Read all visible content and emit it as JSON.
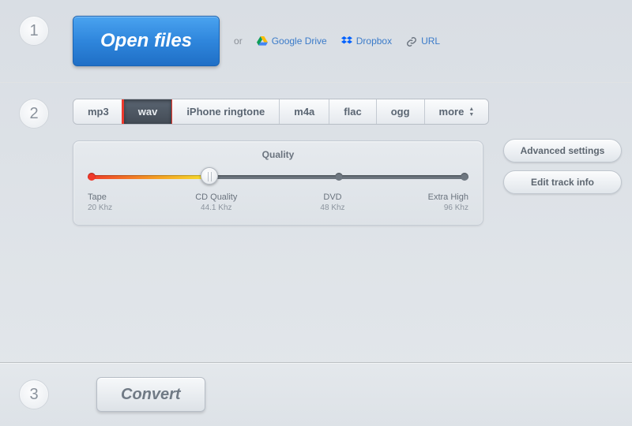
{
  "steps": {
    "one": "1",
    "two": "2",
    "three": "3"
  },
  "open": {
    "button": "Open files",
    "or": "or",
    "sources": {
      "gdrive": "Google Drive",
      "dropbox": "Dropbox",
      "url": "URL"
    }
  },
  "formats": {
    "items": [
      "mp3",
      "wav",
      "iPhone ringtone",
      "m4a",
      "flac",
      "ogg",
      "more"
    ],
    "active_index": 1,
    "highlighted_index": 1
  },
  "quality": {
    "title": "Quality",
    "stops": [
      {
        "label": "Tape",
        "value": "20 Khz"
      },
      {
        "label": "CD Quality",
        "value": "44.1 Khz"
      },
      {
        "label": "DVD",
        "value": "48 Khz"
      },
      {
        "label": "Extra High",
        "value": "96 Khz"
      }
    ],
    "selected_stop": 1
  },
  "side": {
    "advanced": "Advanced settings",
    "edit_track": "Edit track info"
  },
  "convert": {
    "button": "Convert"
  }
}
